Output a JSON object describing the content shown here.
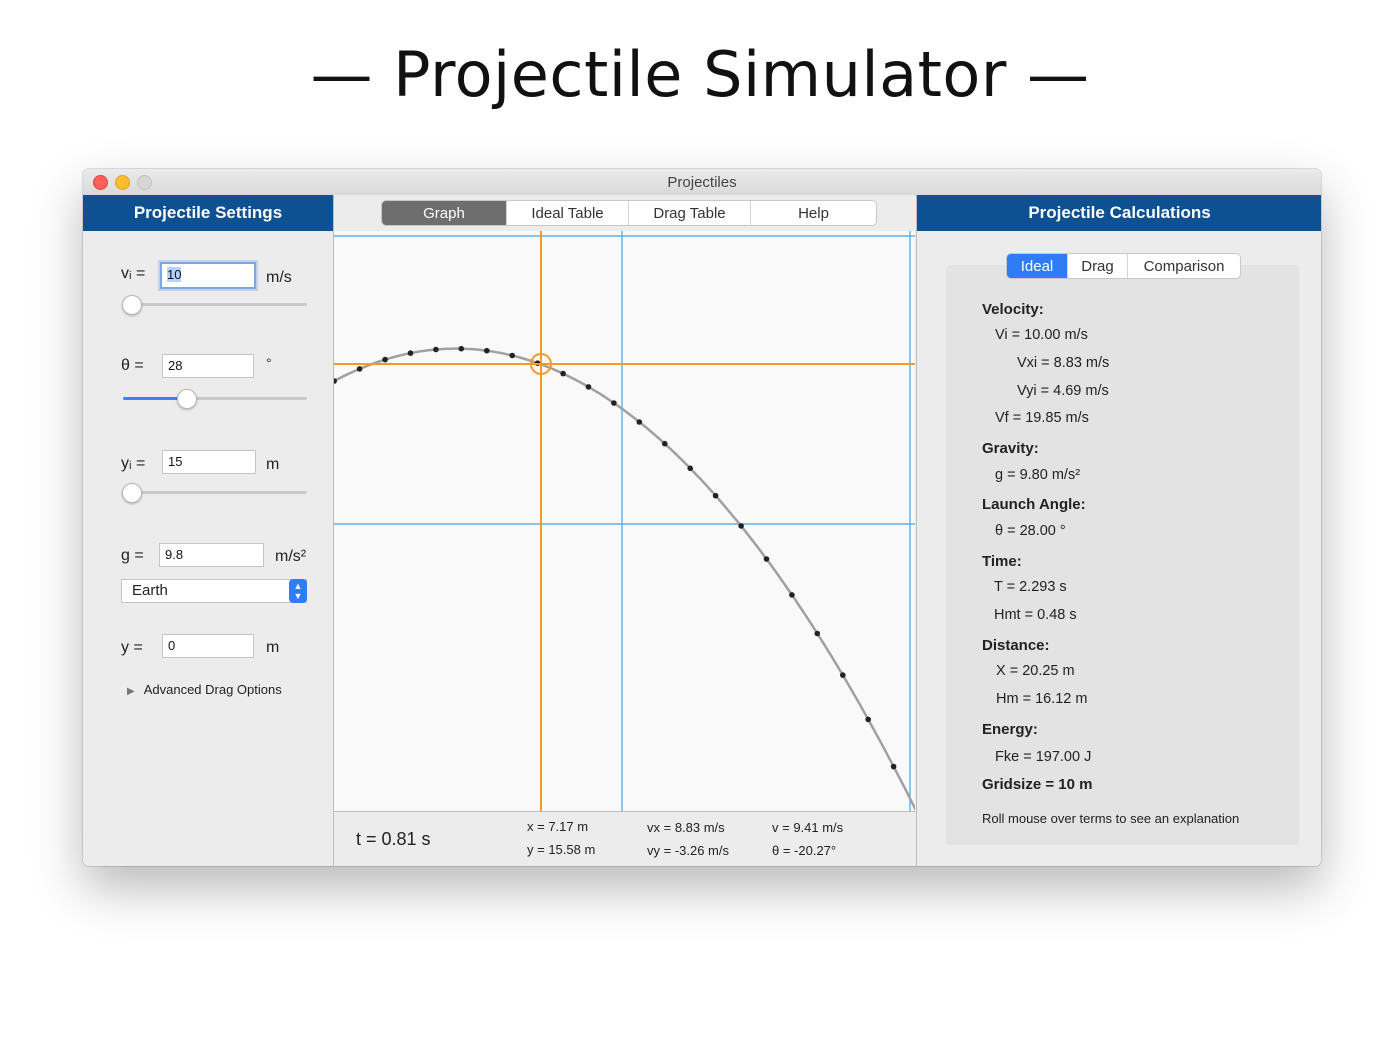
{
  "hero": {
    "title": "— Projectile Simulator —"
  },
  "window": {
    "title": "Projectiles"
  },
  "settings": {
    "title": "Projectile Settings",
    "vi": {
      "label": "vᵢ =",
      "value": "10",
      "unit": "m/s"
    },
    "theta": {
      "label": "θ =",
      "value": "28",
      "unit": "°",
      "slider_fraction": 0.34
    },
    "yi": {
      "label": "yᵢ =",
      "value": "15",
      "unit": "m"
    },
    "g": {
      "label": "g =",
      "value": "9.8",
      "unit": "m/s²",
      "planet": "Earth"
    },
    "y": {
      "label": "y =",
      "value": "0",
      "unit": "m"
    },
    "advanced": "Advanced Drag Options"
  },
  "tabs": [
    "Graph",
    "Ideal Table",
    "Drag Table",
    "Help"
  ],
  "active_tab": "Graph",
  "readout": {
    "t": "t = 0.81 s",
    "x": "x = 7.17 m",
    "y": "y = 15.58 m",
    "vx": "vx = 8.83 m/s",
    "vy": "vy = -3.26 m/s",
    "v": "v = 9.41 m/s",
    "theta": "θ = -20.27°"
  },
  "calculations": {
    "title": "Projectile Calculations",
    "tabs": [
      "Ideal",
      "Drag",
      "Comparison"
    ],
    "active_tab": "Ideal",
    "velocity": {
      "heading": "Velocity:",
      "vi": "Vi = 10.00 m/s",
      "vxi": "Vxi = 8.83 m/s",
      "vyi": "Vyi = 4.69 m/s",
      "vf": "Vf = 19.85 m/s"
    },
    "gravity": {
      "heading": "Gravity:",
      "g": "g = 9.80 m/s²"
    },
    "launch_angle": {
      "heading": "Launch Angle:",
      "theta": "θ = 28.00 °"
    },
    "time": {
      "heading": "Time:",
      "T": "T = 2.293 s",
      "hmt": "Hmt = 0.48 s"
    },
    "distance": {
      "heading": "Distance:",
      "X": "X = 20.25 m",
      "hm": "Hm = 16.12 m"
    },
    "energy": {
      "heading": "Energy:",
      "fke": "Fke = 197.00 J"
    },
    "gridsize": "Gridsize = 10 m",
    "hint": "Roll mouse over terms to see an explanation"
  },
  "colors": {
    "header_blue": "#0e5193",
    "accent_blue": "#2f7cf6",
    "crosshair": "#f59a23",
    "grid": "#4aa3df",
    "trajectory": "#a0a0a0"
  }
}
